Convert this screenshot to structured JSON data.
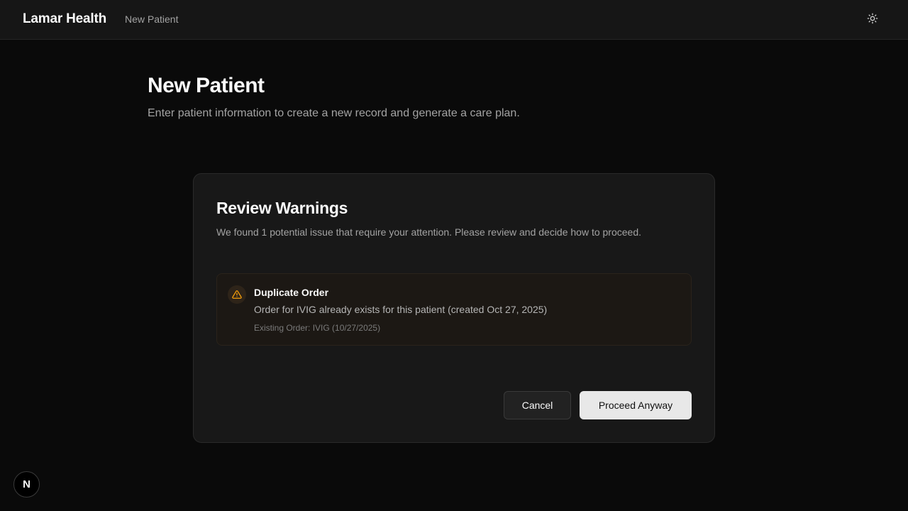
{
  "header": {
    "brand": "Lamar Health",
    "nav_link": "New Patient",
    "theme_icon": "sun-icon"
  },
  "page": {
    "title": "New Patient",
    "subtitle": "Enter patient information to create a new record and generate a care plan."
  },
  "dialog": {
    "title": "Review Warnings",
    "description": "We found 1 potential issue that require your attention. Please review and decide how to proceed.",
    "warnings": [
      {
        "icon": "warning-triangle-icon",
        "title": "Duplicate Order",
        "message": "Order for IVIG already exists for this patient (created Oct 27, 2025)",
        "detail": "Existing Order: IVIG (10/27/2025)"
      }
    ],
    "cancel_label": "Cancel",
    "proceed_label": "Proceed Anyway"
  },
  "dev_badge": {
    "label": "N",
    "icon": "nextjs-icon"
  },
  "colors": {
    "background": "#0a0a0a",
    "dialog_background": "#181818",
    "warning_accent": "#f59e0b",
    "primary_button": "#e8e8e8"
  }
}
